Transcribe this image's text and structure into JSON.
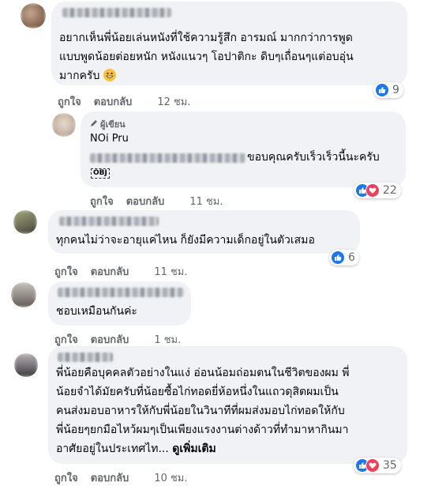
{
  "comments": [
    {
      "text_lines": [
        "อยากเห็นพี่น้อยเล่นหนังที่ใช้ความรู้สึก อารมณ์ มากกว่าการพูด",
        "แบบพูดน้อยต่อยหนัก หนังแนวๆ โอปาติกะ ดิบๆเถื่อนๆแต่อบอุ่น",
        "มากครับ"
      ],
      "emoji": "grinning-face",
      "like_label": "ถูกใจ",
      "reply_label": "ตอบกลับ",
      "time": "12 ชม.",
      "reaction_count": "9"
    },
    {
      "author_label": "ผู้เขียน",
      "author_name": "NOi Pru",
      "text": "ขอบคุณครับเร็วเร็วนี้นะครับ",
      "tag": "OBJ",
      "like_label": "ถูกใจ",
      "reply_label": "ตอบกลับ",
      "time": "11 ชม.",
      "reaction_count": "22"
    },
    {
      "text": "ทุกคนไม่ว่าจะอายุแค่ไหน ก็ยังมีความเด็กอยู่ในตัวเสมอ",
      "like_label": "ถูกใจ",
      "reply_label": "ตอบกลับ",
      "time": "11 ชม.",
      "reaction_count": "6"
    },
    {
      "text": "ชอบเหมือนกันค่ะ",
      "like_label": "ถูกใจ",
      "reply_label": "ตอบกลับ",
      "time": "1 ชม."
    },
    {
      "text_lines": [
        "พี่น้อยคือบุคคลตัวอย่างในแง่ อ่อนน้อมถ่อมตนในชีวิตของผม พี่",
        "น้อยจำได้มัยครับที่น้อยซื้อไก่ทอดยี่ห้อหนึ่งในแถวดุสิตผมเป็น",
        "คนส่งมอบอาหารให้กับพี่น้อยในวินาทีที่ผมส่งมอบไก่ทอดให้กับ",
        "พี่น้อยๆยกมือไหว้ผมๆเป็นเพียงแรงงานต่างด้าวที่ทำมาหากินมา",
        "อาศัยอยู่ในประเทศไท..."
      ],
      "see_more": "ดูเพิ่มเติม",
      "like_label": "ถูกใจ",
      "reply_label": "ตอบกลับ",
      "time": "10 ชม.",
      "reaction_count": "35"
    }
  ],
  "colors": {
    "like_blue": "#1877f2",
    "heart_red": "#f33e58",
    "bubble": "#f0f2f5",
    "meta": "#65676b"
  },
  "icons": {
    "like": "thumbs-up-icon",
    "love": "heart-icon",
    "author": "pencil-icon"
  }
}
